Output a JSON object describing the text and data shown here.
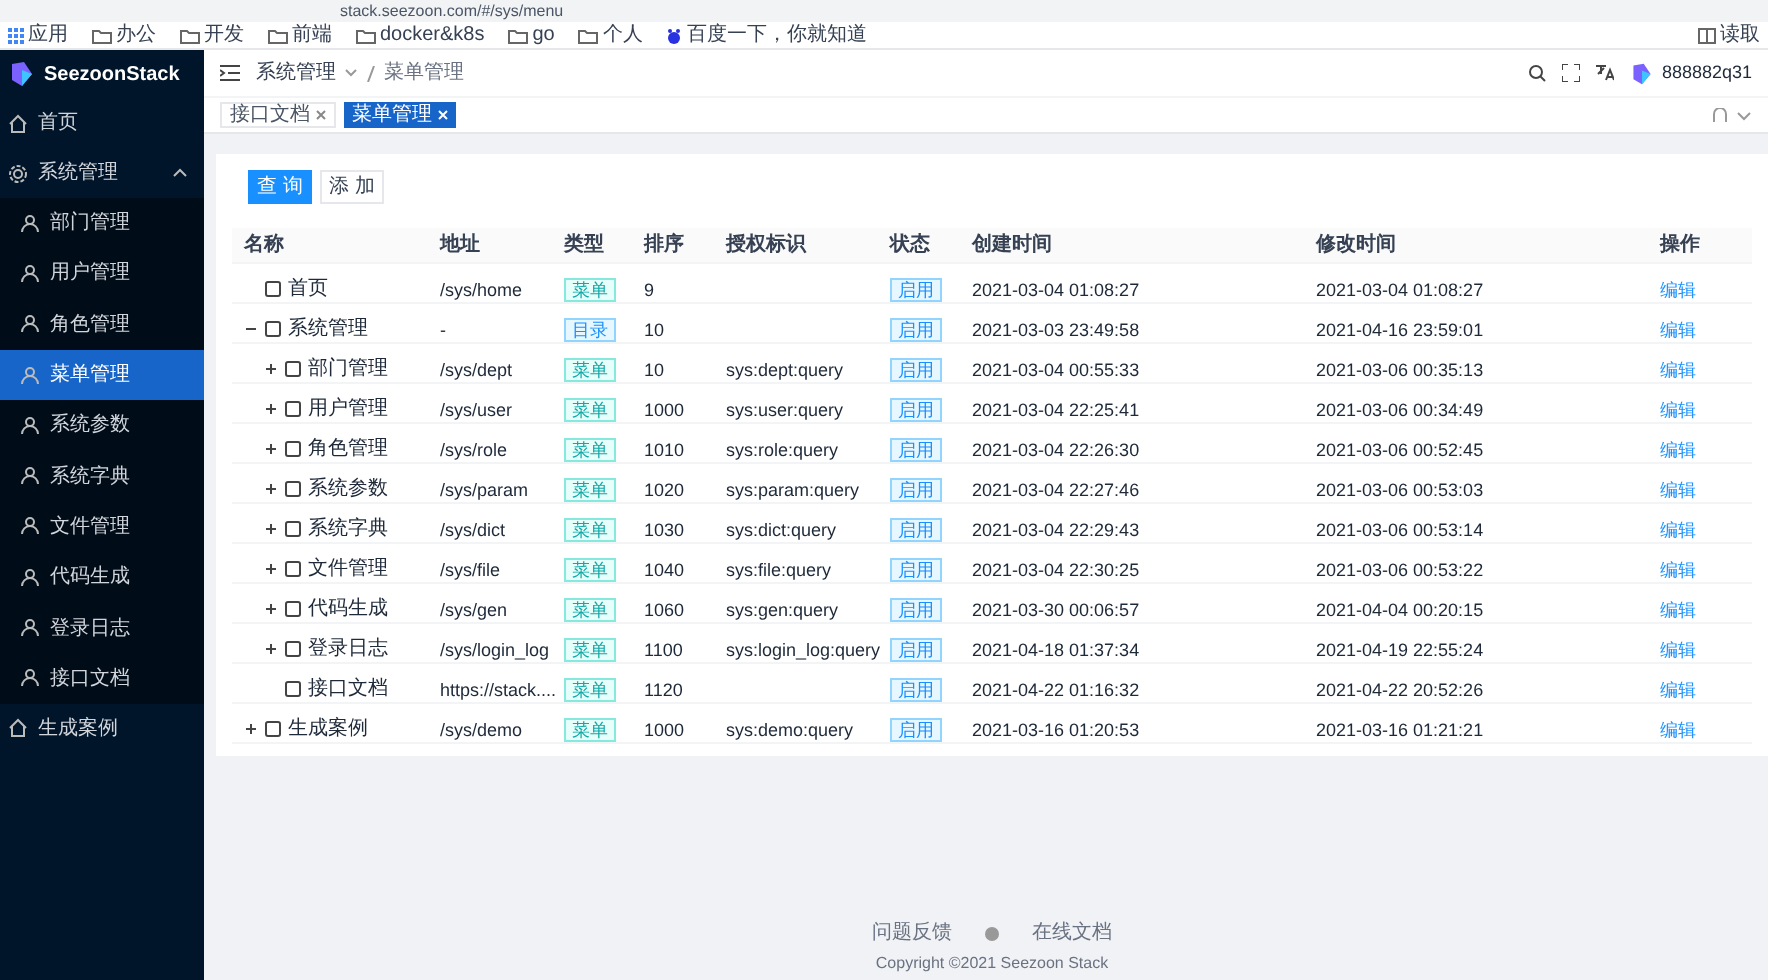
{
  "browser": {
    "url": "stack.seezoon.com/#/sys/menu",
    "bookmarks": [
      "应用",
      "办公",
      "开发",
      "前端",
      "docker&k8s",
      "go",
      "个人",
      "百度一下，你就知道"
    ],
    "reading_list": "读取"
  },
  "sidebar": {
    "brand": "SeezoonStack",
    "items": [
      {
        "label": "首页",
        "selected": false
      },
      {
        "label": "系统管理",
        "expanded": true,
        "selected": false,
        "children": [
          {
            "label": "部门管理",
            "selected": false
          },
          {
            "label": "用户管理",
            "selected": false
          },
          {
            "label": "角色管理",
            "selected": false
          },
          {
            "label": "菜单管理",
            "selected": true
          },
          {
            "label": "系统参数",
            "selected": false
          },
          {
            "label": "系统字典",
            "selected": false
          },
          {
            "label": "文件管理",
            "selected": false
          },
          {
            "label": "代码生成",
            "selected": false
          },
          {
            "label": "登录日志",
            "selected": false
          },
          {
            "label": "接口文档",
            "selected": false
          }
        ]
      },
      {
        "label": "生成案例",
        "selected": false
      }
    ]
  },
  "header": {
    "breadcrumb": [
      "系统管理",
      "菜单管理"
    ],
    "user": "888882q31"
  },
  "tabs": [
    {
      "label": "接口文档",
      "selected": false
    },
    {
      "label": "菜单管理",
      "selected": true
    }
  ],
  "toolbar": {
    "buttons": [
      {
        "label": "查 询",
        "kind": "primary"
      },
      {
        "label": "添 加",
        "kind": "default"
      }
    ]
  },
  "table": {
    "columns": [
      "名称",
      "地址",
      "类型",
      "排序",
      "授权标识",
      "状态",
      "创建时间",
      "修改时间",
      "操作"
    ],
    "rows": [
      {
        "name": "首页",
        "path": "/sys/home",
        "type": "菜单",
        "sort": "9",
        "status": "启用",
        "created": "2021-03-04 01:08:27",
        "updated": "2021-03-04 01:08:27",
        "action": "编辑"
      },
      {
        "name": "系统管理",
        "path": "-",
        "type": "目录",
        "sort": "10",
        "status": "启用",
        "created": "2021-03-03 23:49:58",
        "updated": "2021-04-16 23:59:01",
        "action": "编辑",
        "expanded": true,
        "children": [
          {
            "name": "部门管理",
            "path": "/sys/dept",
            "type": "菜单",
            "sort": "10",
            "perm": "sys:dept:query",
            "status": "启用",
            "created": "2021-03-04 00:55:33",
            "updated": "2021-03-06 00:35:13",
            "action": "编辑",
            "expanded": false
          },
          {
            "name": "用户管理",
            "path": "/sys/user",
            "type": "菜单",
            "sort": "1000",
            "perm": "sys:user:query",
            "status": "启用",
            "created": "2021-03-04 22:25:41",
            "updated": "2021-03-06 00:34:49",
            "action": "编辑",
            "expanded": false
          },
          {
            "name": "角色管理",
            "path": "/sys/role",
            "type": "菜单",
            "sort": "1010",
            "perm": "sys:role:query",
            "status": "启用",
            "created": "2021-03-04 22:26:30",
            "updated": "2021-03-06 00:52:45",
            "action": "编辑",
            "expanded": false
          },
          {
            "name": "系统参数",
            "path": "/sys/param",
            "type": "菜单",
            "sort": "1020",
            "perm": "sys:param:query",
            "status": "启用",
            "created": "2021-03-04 22:27:46",
            "updated": "2021-03-06 00:53:03",
            "action": "编辑",
            "expanded": false
          },
          {
            "name": "系统字典",
            "path": "/sys/dict",
            "type": "菜单",
            "sort": "1030",
            "perm": "sys:dict:query",
            "status": "启用",
            "created": "2021-03-04 22:29:43",
            "updated": "2021-03-06 00:53:14",
            "action": "编辑",
            "expanded": false
          },
          {
            "name": "文件管理",
            "path": "/sys/file",
            "type": "菜单",
            "sort": "1040",
            "perm": "sys:file:query",
            "status": "启用",
            "created": "2021-03-04 22:30:25",
            "updated": "2021-03-06 00:53:22",
            "action": "编辑",
            "expanded": false
          },
          {
            "name": "代码生成",
            "path": "/sys/gen",
            "type": "菜单",
            "sort": "1060",
            "perm": "sys:gen:query",
            "status": "启用",
            "created": "2021-03-30 00:06:57",
            "updated": "2021-04-04 00:20:15",
            "action": "编辑",
            "expanded": false
          },
          {
            "name": "登录日志",
            "path": "/sys/login_log",
            "type": "菜单",
            "sort": "1100",
            "perm": "sys:login_log:query",
            "status": "启用",
            "created": "2021-04-18 01:37:34",
            "updated": "2021-04-19 22:55:24",
            "action": "编辑",
            "expanded": false
          },
          {
            "name": "接口文档",
            "path": "https://stack....",
            "type": "菜单",
            "sort": "1120",
            "status": "启用",
            "created": "2021-04-22 01:16:32",
            "updated": "2021-04-22 20:52:26",
            "action": "编辑"
          }
        ]
      },
      {
        "name": "生成案例",
        "path": "/sys/demo",
        "type": "菜单",
        "sort": "1000",
        "perm": "sys:demo:query",
        "status": "启用",
        "created": "2021-03-16 01:20:53",
        "updated": "2021-03-16 01:21:21",
        "action": "编辑",
        "expanded": false
      }
    ]
  },
  "footer": {
    "links": [
      "问题反馈",
      "在线文档"
    ],
    "copyright": "Copyright ©2021 Seezoon Stack"
  }
}
